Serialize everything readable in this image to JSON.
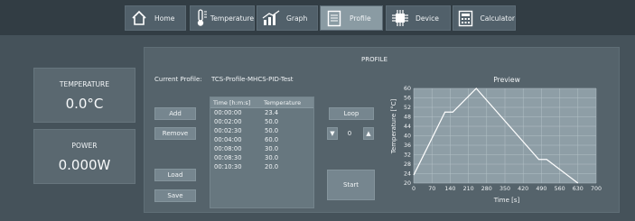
{
  "nav": {
    "home": "Home",
    "temperature": "Temperature",
    "graph": "Graph",
    "profile": "Profile",
    "device": "Device",
    "calculator": "Calculator"
  },
  "temperature": {
    "label": "TEMPERATURE",
    "value": "0.0°C"
  },
  "power": {
    "label": "POWER",
    "value": "0.000W"
  },
  "profile": {
    "title": "PROFILE",
    "current_label": "Current Profile:",
    "current_value": "TCS-Profile-MHCS-PID-Test",
    "buttons": {
      "add": "Add",
      "remove": "Remove",
      "load": "Load",
      "save": "Save",
      "loop": "Loop",
      "start": "Start"
    },
    "loop_count": "0",
    "table": {
      "headers": [
        "Time [h:m:s]",
        "Temperature"
      ],
      "rows": [
        [
          "00:00:00",
          "23.4"
        ],
        [
          "00:02:00",
          "50.0"
        ],
        [
          "00:02:30",
          "50.0"
        ],
        [
          "00:04:00",
          "60.0"
        ],
        [
          "00:08:00",
          "30.0"
        ],
        [
          "00:08:30",
          "30.0"
        ],
        [
          "00:10:30",
          "20.0"
        ]
      ]
    }
  },
  "colors": {
    "accent": "#8a9ba3",
    "plot_bg": "#8e9ea6",
    "line": "#ffffff"
  },
  "chart_data": {
    "type": "line",
    "title": "Preview",
    "xlabel": "Time [s]",
    "ylabel": "Temperature [°C]",
    "xlim": [
      0,
      700
    ],
    "ylim": [
      20,
      60
    ],
    "xticks": [
      0,
      70,
      140,
      210,
      280,
      350,
      420,
      490,
      560,
      630,
      700
    ],
    "yticks": [
      20,
      24,
      28,
      32,
      36,
      40,
      44,
      48,
      52,
      56,
      60
    ],
    "grid": true,
    "x": [
      0,
      120,
      150,
      240,
      480,
      510,
      630
    ],
    "y": [
      23.4,
      50,
      50,
      60,
      30,
      30,
      20
    ]
  }
}
